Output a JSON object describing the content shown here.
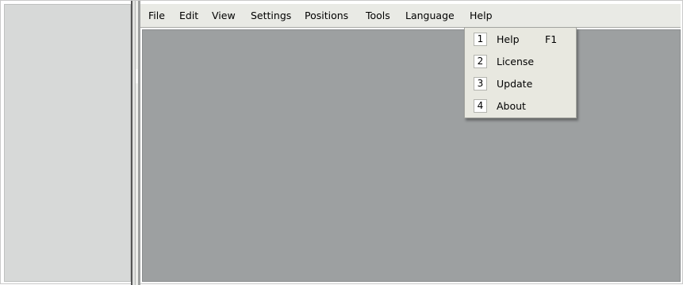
{
  "menubar": {
    "items": [
      {
        "label": "File"
      },
      {
        "label": "Edit"
      },
      {
        "label": "View"
      },
      {
        "label": "Settings"
      },
      {
        "label": "Positions"
      },
      {
        "label": "Tools"
      },
      {
        "label": "Language"
      },
      {
        "label": "Help"
      }
    ]
  },
  "help_menu": {
    "items": [
      {
        "number": "1",
        "label": "Help",
        "shortcut": "F1"
      },
      {
        "number": "2",
        "label": "License"
      },
      {
        "number": "3",
        "label": "Update"
      },
      {
        "number": "4",
        "label": "About"
      }
    ]
  }
}
